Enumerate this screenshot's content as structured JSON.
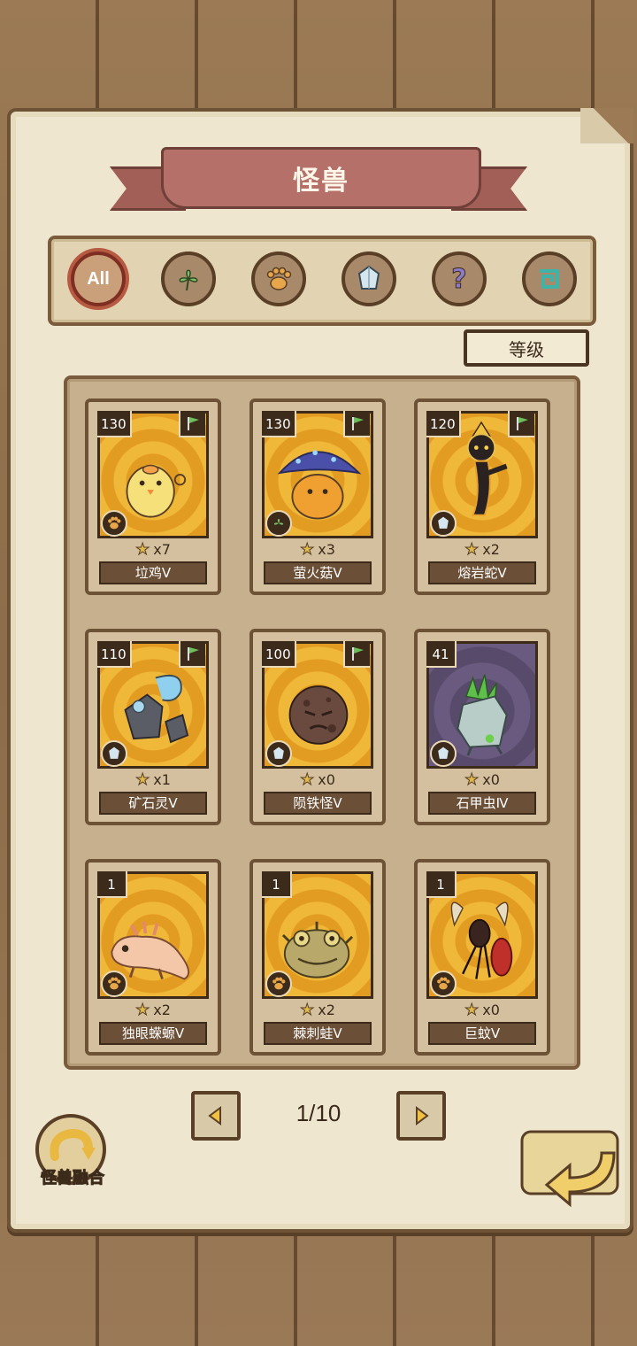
{
  "header": {
    "title": "怪兽"
  },
  "filters": [
    {
      "label": "All",
      "icon": "all-icon",
      "active": true
    },
    {
      "label": "",
      "icon": "leaf-icon",
      "active": false
    },
    {
      "label": "",
      "icon": "paw-icon",
      "active": false
    },
    {
      "label": "",
      "icon": "crystal-icon",
      "active": false
    },
    {
      "label": "",
      "icon": "question-icon",
      "active": false
    },
    {
      "label": "",
      "icon": "spiral-icon",
      "active": false
    }
  ],
  "sort": {
    "label": "等级"
  },
  "monsters": [
    {
      "level": "130",
      "count": "x7",
      "name": "垃鸡Ⅴ",
      "type_icon": "paw-icon",
      "flag": true,
      "bg": "gold"
    },
    {
      "level": "130",
      "count": "x3",
      "name": "萤火菇Ⅴ",
      "type_icon": "leaf-icon",
      "flag": true,
      "bg": "gold"
    },
    {
      "level": "120",
      "count": "x2",
      "name": "熔岩蛇Ⅴ",
      "type_icon": "crystal-icon",
      "flag": true,
      "bg": "gold"
    },
    {
      "level": "110",
      "count": "x1",
      "name": "矿石灵Ⅴ",
      "type_icon": "crystal-icon",
      "flag": true,
      "bg": "gold"
    },
    {
      "level": "100",
      "count": "x0",
      "name": "陨铁怪Ⅴ",
      "type_icon": "crystal-icon",
      "flag": true,
      "bg": "gold"
    },
    {
      "level": "41",
      "count": "x0",
      "name": "石甲虫Ⅳ",
      "type_icon": "crystal-icon",
      "flag": false,
      "bg": "purple"
    },
    {
      "level": "1",
      "count": "x2",
      "name": "独眼蝾螈Ⅴ",
      "type_icon": "paw-icon",
      "flag": false,
      "bg": "gold"
    },
    {
      "level": "1",
      "count": "x2",
      "name": "棘刺蛙Ⅴ",
      "type_icon": "paw-icon",
      "flag": false,
      "bg": "gold"
    },
    {
      "level": "1",
      "count": "x0",
      "name": "巨蚊Ⅴ",
      "type_icon": "paw-icon",
      "flag": false,
      "bg": "gold"
    }
  ],
  "pager": {
    "text": "1/10",
    "prev_icon": "arrow-left-icon",
    "next_icon": "arrow-right-icon"
  },
  "fusion": {
    "label": "怪兽融合"
  },
  "back": {
    "icon": "back-arrow-icon"
  }
}
